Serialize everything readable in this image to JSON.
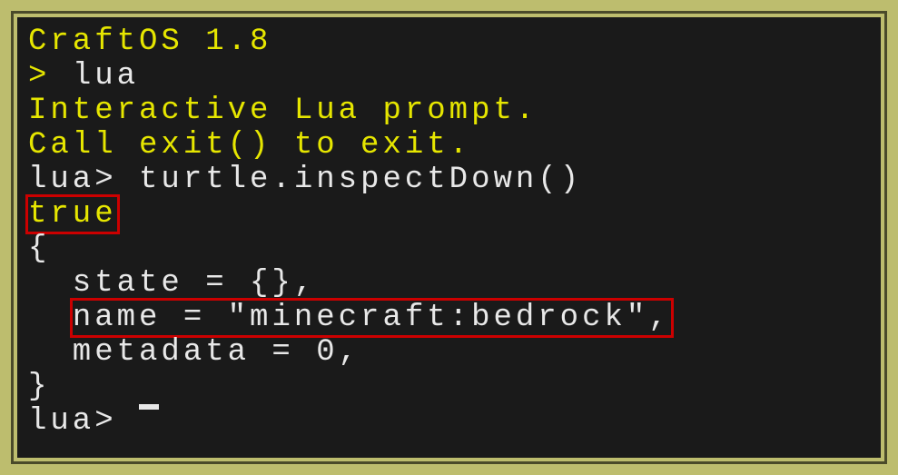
{
  "terminal": {
    "header": "CraftOS 1.8",
    "prompt1_symbol": "> ",
    "prompt1_cmd": "lua",
    "interactive_line1": "Interactive Lua prompt.",
    "interactive_line2": "Call exit() to exit.",
    "lua_prompt_symbol": "lua> ",
    "lua_cmd": "turtle.inspectDown()",
    "result_true": "true",
    "brace_open": "{",
    "state_line": "  state = {},",
    "name_indent": "  ",
    "name_line": "name = \"minecraft:bedrock\",",
    "metadata_line": "  metadata = 0,",
    "brace_close": "}",
    "final_prompt": "lua> "
  }
}
